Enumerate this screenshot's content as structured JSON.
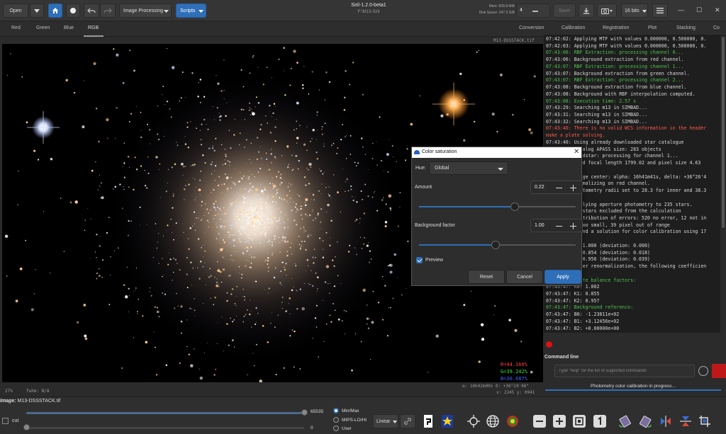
{
  "header": {
    "open_label": "Open",
    "image_processing_label": "Image Processing",
    "scripts_label": "Scripts",
    "title": "Siril-1.2.0-beta1",
    "subtitle": "F:\\M13-Siril",
    "mem": "Mem: 509.8 MiB",
    "disk": "Disk Space: 247.3 GiB",
    "threads_value": "4",
    "save_label": "Save",
    "bits_label": "16 bits",
    "close_glyph": "✕",
    "min_glyph": "—",
    "max_glyph": "☐"
  },
  "image_tabs": [
    "Red",
    "Green",
    "Blue",
    "RGB"
  ],
  "image_filename_tr": "M13-DSSSTACK.tif",
  "readouts": {
    "r": "R=44.160%",
    "g": "G=39.242%",
    "b": "B=30.687%",
    "coords": "α: 16h42m00s δ: +36°24'46\"",
    "xy": "x: 2245 y: 0941"
  },
  "status": {
    "zoom": "27%",
    "fwhm": "fwhm: N/A"
  },
  "right_tabs": [
    "Conversion",
    "Calibration",
    "Registration",
    "Plot",
    "Stacking",
    "Co"
  ],
  "console_lines": [
    {
      "t": "07:42:02: Applying MTF with values 0.000000, 0.500000, 0.",
      "c": "#d8d8d8"
    },
    {
      "t": "07:42:03: Applying MTF with values 0.000000, 0.500000, 0.",
      "c": "#d8d8d8"
    },
    {
      "t": "07:43:06: RBF Extraction: processing channel 0...",
      "c": "#4fc04f"
    },
    {
      "t": "07:43:06: Background extraction from red channel.",
      "c": "#d8d8d8"
    },
    {
      "t": "07:43:07: RBF Extraction: processing channel 1...",
      "c": "#4fc04f"
    },
    {
      "t": "07:43:07: Background extraction from green channel.",
      "c": "#d8d8d8"
    },
    {
      "t": "07:43:07: RBF Extraction: processing channel 2...",
      "c": "#4fc04f"
    },
    {
      "t": "07:43:08: Background extraction from blue channel.",
      "c": "#d8d8d8"
    },
    {
      "t": "07:43:08: Background with RBF interpolation computed.",
      "c": "#d8d8d8"
    },
    {
      "t": "07:43:08: Execution time: 2.57 s",
      "c": "#4fc04f"
    },
    {
      "t": "07:43:29: Searching m13 in SIMBAD...",
      "c": "#d8d8d8"
    },
    {
      "t": "07:43:31: Searching m13 in SIMBAD...",
      "c": "#d8d8d8"
    },
    {
      "t": "07:43:32: Searching m13 in SIMBAD...",
      "c": "#d8d8d8"
    },
    {
      "t": "07:43:40: There is no valid WCS information in the header",
      "c": "#ff5a4a"
    },
    {
      "t": "make a plate solving.",
      "c": "#ff5a4a"
    },
    {
      "t": "07:43:40: Using already downloaded star catalogue",
      "c": "#d8d8d8"
    },
    {
      "t": "07:43:40: Catalog APASS size: 283 objects",
      "c": "#d8d8d8"
    },
    {
      "t": "07:43:40: findstar: processing for channel 1...",
      "c": "#d8d8d8"
    },
    {
      "t": "07:43:40: Used focal length 1799.02 and pixel size 4.63",
      "c": "#d8d8d8"
    },
    {
      "t": "07:43:40: us",
      "c": "#d8d8d8"
    },
    {
      "t": "07:43:40: Image center: alpha: 16h41m41s, delta: +36°26'4",
      "c": "#d8d8d8"
    },
    {
      "t": "07:43:40: Normalizing on red channel.",
      "c": "#d8d8d8"
    },
    {
      "t": "07:43:40: Photometry radii set to 28.3 for inner and 38.3",
      "c": "#d8d8d8"
    },
    {
      "t": "",
      "c": "#d8d8d8"
    },
    {
      "t": "07:43:40: Applying aperture photometry to 235 stars.",
      "c": "#d8d8d8"
    },
    {
      "t": "07:43:47: 59 stars excluded from the calculation",
      "c": "#d8d8d8"
    },
    {
      "t": "07:43:47: Distribution of errors: 520 no error, 12 not in",
      "c": "#d8d8d8"
    },
    {
      "t": "07:43:47: 3 too small, 39 pixel out of range",
      "c": "#d8d8d8"
    },
    {
      "t": "07:43:47: Found a solution for color calibration using 17",
      "c": "#d8d8d8"
    },
    {
      "t": "",
      "c": "#d8d8d8"
    },
    {
      "t": "07:43:47: R: 1.000     (deviation: 0.000)",
      "c": "#d8d8d8"
    },
    {
      "t": "07:43:47: G: 0.854     (deviation: 0.018)",
      "c": "#d8d8d8"
    },
    {
      "t": "07:43:47: B: 0.956     (deviation: 0.039)",
      "c": "#d8d8d8"
    },
    {
      "t": "07:43:47: After renormalization, the following coefficien",
      "c": "#d8d8d8"
    },
    {
      "t": "",
      "c": "#d8d8d8"
    },
    {
      "t": "07:43:47: White balance factors:",
      "c": "#4fc04f"
    },
    {
      "t": "07:43:47: K0: 1.002",
      "c": "#d8d8d8"
    },
    {
      "t": "07:43:47: K1: 0.855",
      "c": "#d8d8d8"
    },
    {
      "t": "07:43:47: K2: 0.957",
      "c": "#d8d8d8"
    },
    {
      "t": "07:43:47: Background reference:",
      "c": "#4fc04f"
    },
    {
      "t": "07:43:47: B0: -1.23811e+02",
      "c": "#d8d8d8"
    },
    {
      "t": "07:43:47: B1: +3.12456e+02",
      "c": "#d8d8d8"
    },
    {
      "t": "07:43:47: B2: +0.00000e+00",
      "c": "#d8d8d8"
    }
  ],
  "command": {
    "label": "Command line",
    "placeholder": "Type \"help\" for the list of supported commands"
  },
  "progress_text": "Photometry color calibration in progress...",
  "bottom": {
    "image_label": "Image:",
    "image_name": "M13-DSSSTACK.tif",
    "hi_value": "65535",
    "lo_value": "0",
    "cut_label": "cut",
    "radio_options": [
      "Min/Max",
      "MIPS-LO/HI",
      "User"
    ],
    "selected_radio": 0,
    "display_mode": "Linear"
  },
  "dialog": {
    "title": "Color saturation",
    "hue_label": "Hue:",
    "hue_value": "Global",
    "amount_label": "Amount",
    "amount_value": "0.22",
    "amount_level": 0.61,
    "bg_label": "Background factor",
    "bg_value": "1.00",
    "bg_level": 0.49,
    "preview_label": "Preview",
    "reset_label": "Reset",
    "cancel_label": "Cancel",
    "apply_label": "Apply"
  },
  "colors": {
    "accent": "#2f6fb8",
    "log_green": "#4fc04f",
    "log_red": "#ff5a4a"
  }
}
